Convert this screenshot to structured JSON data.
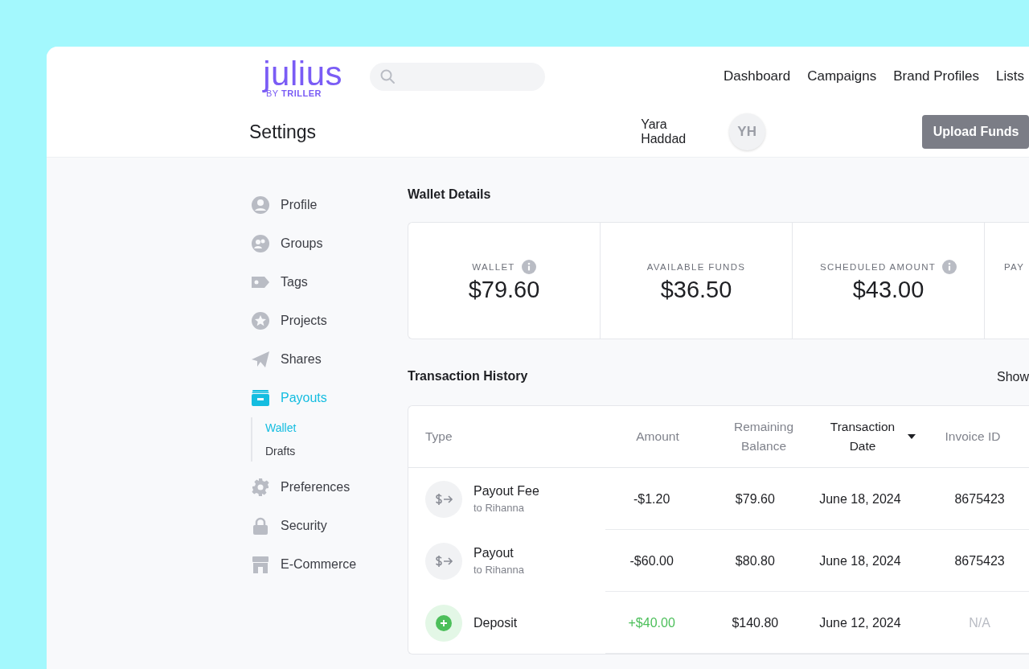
{
  "logo": {
    "wordmark": "julius",
    "byline": "BY **TRILLER**"
  },
  "nav": [
    "Dashboard",
    "Campaigns",
    "Brand Profiles",
    "Lists"
  ],
  "page_title": "Settings",
  "user": {
    "name": "Yara Haddad",
    "initials": "YH"
  },
  "primary_button": "Upload Funds",
  "sidebar": {
    "items": [
      {
        "label": "Profile",
        "selected": false
      },
      {
        "label": "Groups",
        "selected": false
      },
      {
        "label": "Tags",
        "selected": false
      },
      {
        "label": "Projects",
        "selected": false
      },
      {
        "label": "Shares",
        "selected": false
      },
      {
        "label": "Payouts",
        "selected": true,
        "children": [
          {
            "label": "Wallet",
            "selected": true
          },
          {
            "label": "Drafts",
            "selected": false
          }
        ]
      },
      {
        "label": "Preferences",
        "selected": false
      },
      {
        "label": "Security",
        "selected": false
      },
      {
        "label": "E-Commerce",
        "selected": false
      }
    ]
  },
  "wallet_details": {
    "title": "Wallet Details",
    "cards": [
      {
        "label": "WALLET",
        "info": true,
        "value": "$79.60"
      },
      {
        "label": "AVAILABLE FUNDS",
        "value": "$36.50"
      },
      {
        "label": "SCHEDULED AMOUNT",
        "info": true,
        "value": "$43.00"
      },
      {
        "label": "PAY"
      }
    ]
  },
  "transaction_history": {
    "title": "Transaction History",
    "show_label": "Show",
    "columns": [
      {
        "label": "Type",
        "sorted": false
      },
      {
        "label": "Amount",
        "sorted": false
      },
      {
        "label": "Remaining Balance",
        "sorted": false
      },
      {
        "label": "Transaction Date",
        "sorted": true
      },
      {
        "label": "Invoice ID",
        "sorted": false
      }
    ],
    "rows": [
      {
        "kind": "payout",
        "type": "Payout Fee",
        "recipient": "to Rihanna",
        "amount": "-$1.20",
        "remaining": "$79.60",
        "date": "June 18, 2024",
        "invoice": "8675423",
        "invoice_available": true
      },
      {
        "kind": "payout",
        "type": "Payout",
        "recipient": "to Rihanna",
        "amount": "-$60.00",
        "remaining": "$80.80",
        "date": "June 18, 2024",
        "invoice": "8675423",
        "invoice_available": true
      },
      {
        "kind": "deposit",
        "type": "Deposit",
        "amount": "+$40.00",
        "remaining": "$140.80",
        "date": "June 12, 2024",
        "invoice": "N/A",
        "invoice_available": false
      }
    ]
  }
}
